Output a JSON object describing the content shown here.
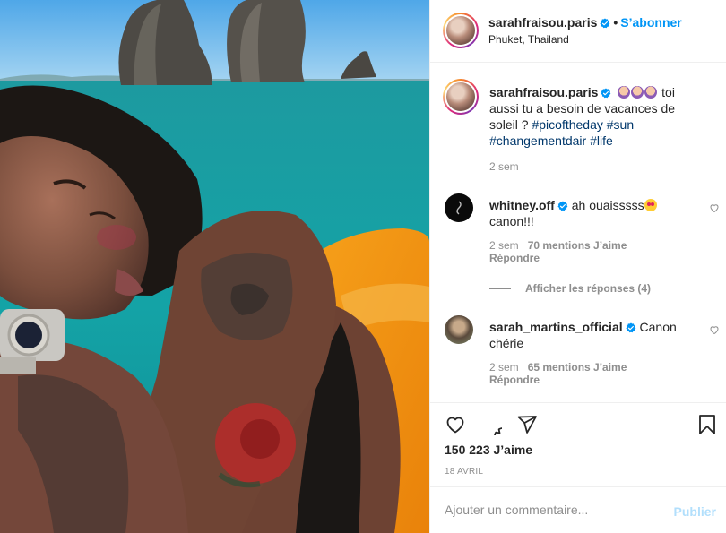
{
  "post": {
    "username": "sarahfraisou.paris",
    "follow_label": "S’abonner",
    "separator": "•",
    "location": "Phuket, Thailand"
  },
  "caption": {
    "username": "sarahfraisou.paris",
    "text": " toi aussi tu a besoin de vacances de soleil ? ",
    "hashtags": [
      "#picoftheday",
      "#sun",
      "#changementdair",
      "#life"
    ],
    "time": "2 sem"
  },
  "comments": [
    {
      "username": "whitney.off",
      "text": " ah ouaisssss",
      "text2": "canon!!!",
      "time": "2 sem",
      "likes": "70 mentions J’aime",
      "reply": "Répondre",
      "view_replies": "Afficher les réponses (4)"
    },
    {
      "username": "sarah_martins_official",
      "text": " Canon chérie",
      "time": "2 sem",
      "likes": "65 mentions J’aime",
      "reply": "Répondre"
    }
  ],
  "actions": {
    "likes": "150 223 J’aime",
    "date": "18 avril"
  },
  "composer": {
    "placeholder": "Ajouter un commentaire...",
    "publish": "Publier"
  },
  "colors": {
    "link": "#0095f6",
    "hashtag": "#00376b",
    "muted": "#8e8e8e",
    "border": "#efefef",
    "publish_disabled": "#b2dffc"
  },
  "icons": [
    "verified-badge-icon",
    "heart-icon",
    "comment-icon",
    "share-icon",
    "bookmark-icon"
  ]
}
